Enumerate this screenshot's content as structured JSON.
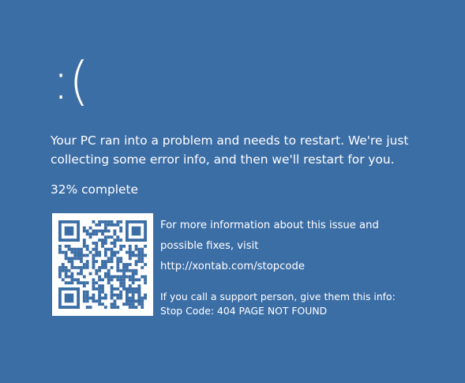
{
  "screen": {
    "sad_face": ":(",
    "message": "Your PC ran into a problem and needs to restart. We're just\ncollecting some error info, and then we'll restart for you.",
    "progress_text": "32% complete",
    "progress_value": 32,
    "info": {
      "line1": "For more information about this issue and",
      "line2": "possible fixes, visit",
      "url": "http://xontab.com/stopcode"
    },
    "support": {
      "prompt": "If you call a support person, give them this info:",
      "stop_code": "Stop Code: 404 PAGE NOT FOUND"
    },
    "qr_icon": "qr-code-icon",
    "colors": {
      "background": "#3c6ea6",
      "text": "#ffffff",
      "qr": "#3c6ea6",
      "qr_background": "#ffffff"
    }
  }
}
